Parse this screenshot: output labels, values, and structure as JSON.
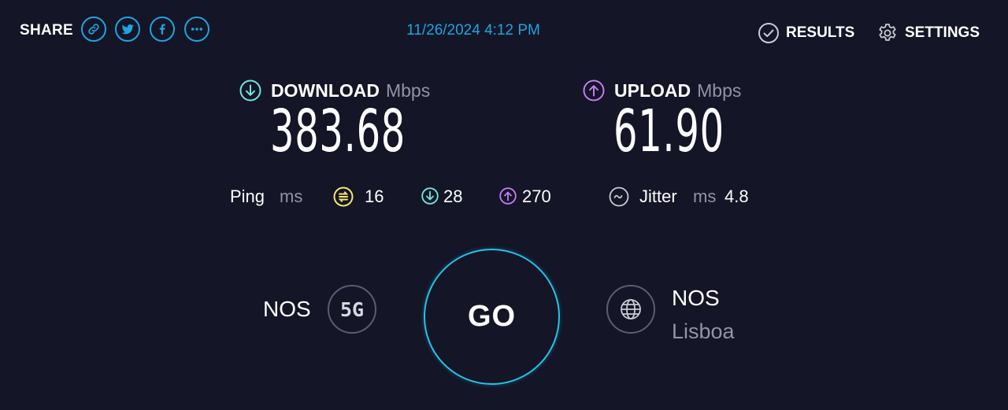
{
  "header": {
    "share_label": "SHARE",
    "share_icons": [
      "link-icon",
      "twitter-icon",
      "facebook-icon",
      "more-icon"
    ],
    "datetime": "11/26/2024 4:12 PM",
    "results_label": "RESULTS",
    "settings_label": "SETTINGS"
  },
  "download": {
    "label": "DOWNLOAD",
    "unit": "Mbps",
    "value": "383.68"
  },
  "upload": {
    "label": "UPLOAD",
    "unit": "Mbps",
    "value": "61.90"
  },
  "ping": {
    "label": "Ping",
    "unit": "ms",
    "idle": "16",
    "download": "28",
    "upload": "270"
  },
  "jitter": {
    "label": "Jitter",
    "unit": "ms",
    "value": "4.8"
  },
  "connection": {
    "isp": "NOS",
    "type": "5G"
  },
  "go": {
    "label": "GO"
  },
  "server": {
    "name": "NOS",
    "location": "Lisboa"
  },
  "colors": {
    "background": "#141526",
    "accent_blue": "#1ea4e0",
    "download_cyan": "#6ee7e0",
    "upload_purple": "#c17cf0",
    "ping_yellow": "#f5e76e",
    "muted": "#9193a8"
  }
}
